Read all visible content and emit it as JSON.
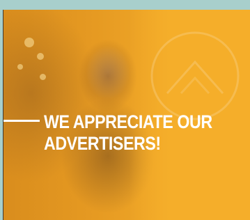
{
  "ad": {
    "headline_line1": "WE APPRECIATE OUR",
    "headline_line2": "ADVERTISERS!"
  },
  "colors": {
    "background": "#a8cfcc",
    "panel": "#f5ae2a",
    "text": "#ffffff"
  }
}
